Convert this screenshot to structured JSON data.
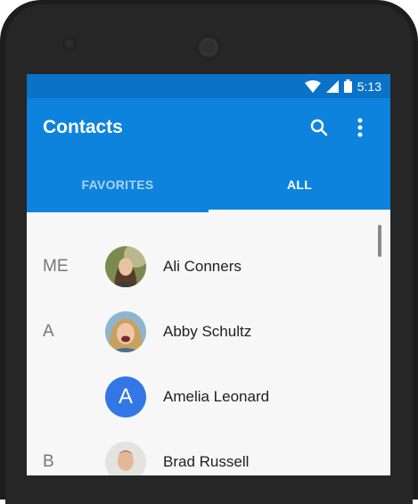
{
  "status_bar": {
    "time": "5:13"
  },
  "app_bar": {
    "title": "Contacts"
  },
  "tabs": [
    {
      "label": "FAVORITES",
      "active": false
    },
    {
      "label": "ALL",
      "active": true
    }
  ],
  "contacts": [
    {
      "section": "ME",
      "name": "Ali Conners",
      "avatar": "photo"
    },
    {
      "section": "A",
      "name": "Abby Schultz",
      "avatar": "photo"
    },
    {
      "section": "",
      "name": "Amelia Leonard",
      "avatar": "letter",
      "letter": "A"
    },
    {
      "section": "B",
      "name": "Brad Russell",
      "avatar": "photo"
    }
  ],
  "colors": {
    "primary": "#0d83dd",
    "status": "#0a72c7",
    "letter_avatar": "#3377e6"
  }
}
